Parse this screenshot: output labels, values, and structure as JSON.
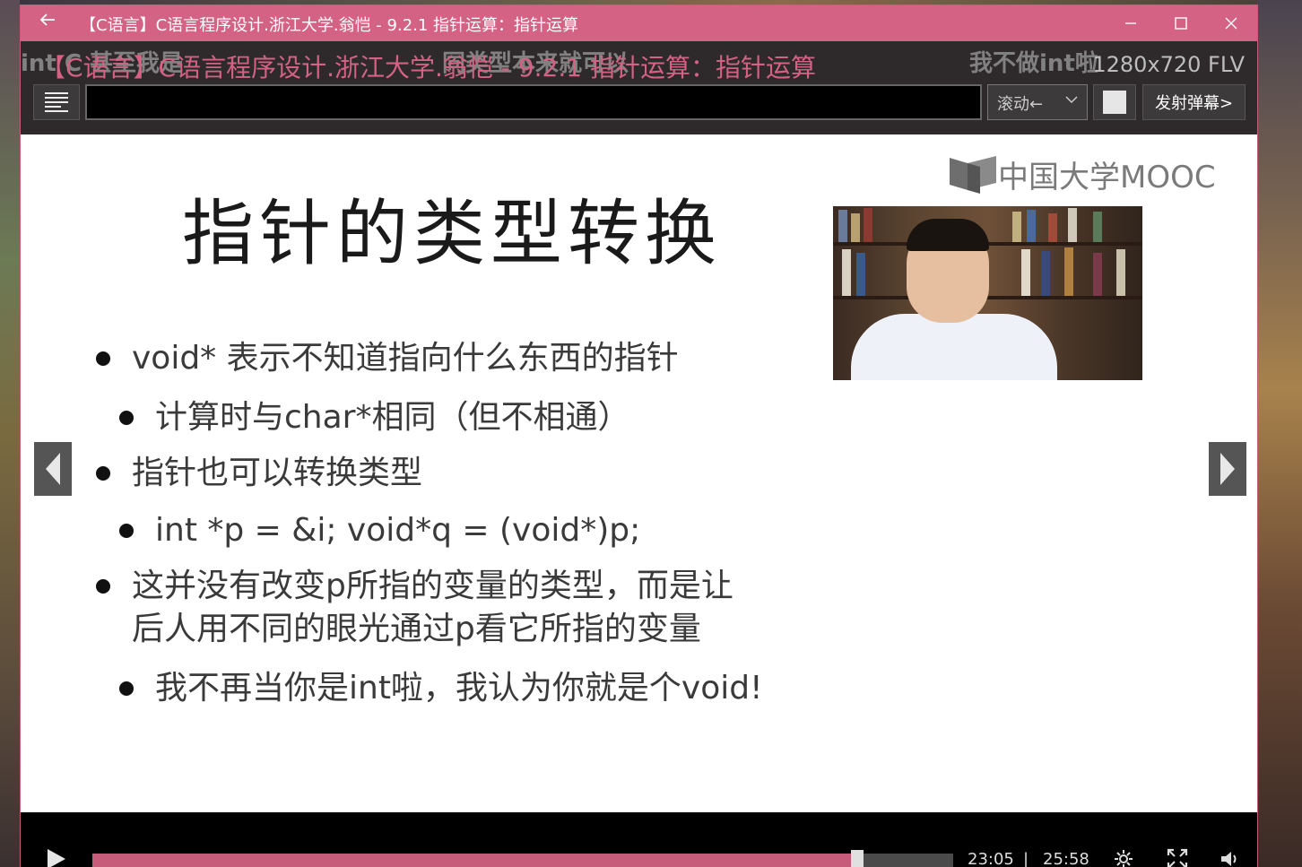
{
  "window": {
    "back_icon": "arrow-left-icon",
    "title": "【C语言】C语言程序设计.浙江大学.翁恺 - 9.2.1 指针运算：指针运算",
    "minimize_icon": "minimize-icon",
    "maximize_icon": "maximize-icon",
    "close_icon": "close-icon"
  },
  "player": {
    "video_title": "【C语言】C语言程序设计.浙江大学.翁恺 - 9.2.1 指针运算：指针运算",
    "resolution": "1280x720 FLV",
    "danmaku": [
      "int C 甚至我是",
      "同类型本来就可以",
      "我不做int啦"
    ],
    "danmu_input": {
      "value": "",
      "placeholder": ""
    },
    "mode_select": {
      "selected": "滚动←"
    },
    "send_label": "发射弹幕>"
  },
  "slide": {
    "logo_text": "中国大学MOOC",
    "title": "指针的类型转换",
    "bullets": [
      {
        "level": 1,
        "text": "void* 表示不知道指向什么东西的指针"
      },
      {
        "level": 2,
        "text": "计算时与char*相同（但不相通）"
      },
      {
        "level": 1,
        "text": "指针也可以转换类型"
      },
      {
        "level": 2,
        "text": "int *p = &i; void*q = (void*)p;"
      },
      {
        "level": 1,
        "text": "这并没有改变p所指的变量的类型，而是让"
      },
      {
        "level": 0,
        "text": "后人用不同的眼光通过p看它所指的变量"
      },
      {
        "level": 2,
        "text": "我不再当你是int啦，我认为你就是个void!"
      }
    ]
  },
  "controls": {
    "current_time": "23:05",
    "separator": "|",
    "total_time": "25:58",
    "progress_fraction": 0.889,
    "play_icon": "play-icon",
    "settings_icon": "gear-icon",
    "fullscreen_icon": "fullscreen-icon",
    "volume_icon": "volume-icon"
  },
  "colors": {
    "accent": "#d36285",
    "progress": "#c75b7a"
  }
}
